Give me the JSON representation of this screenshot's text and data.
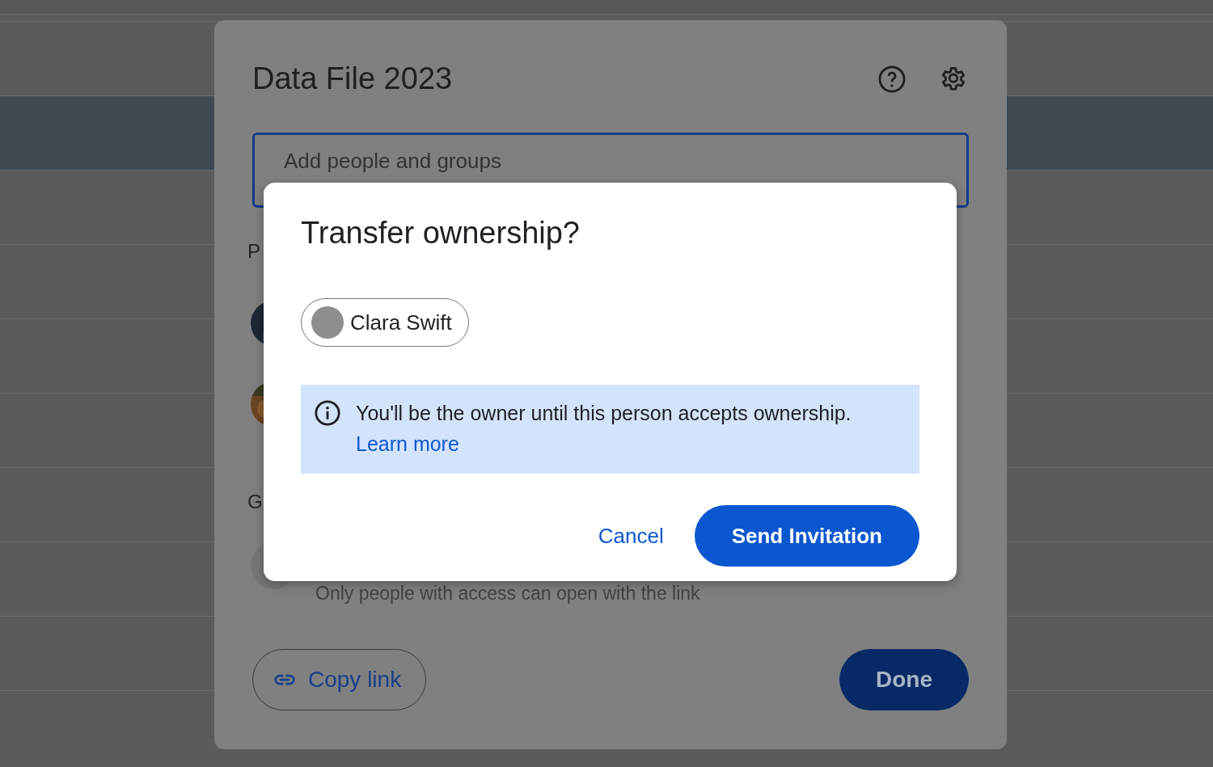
{
  "background_rows": [
    {
      "selected": false
    },
    {
      "selected": true
    },
    {
      "selected": false
    },
    {
      "selected": false
    },
    {
      "selected": false
    },
    {
      "selected": false
    },
    {
      "selected": false
    },
    {
      "selected": false
    },
    {
      "selected": false
    },
    {
      "selected": false
    }
  ],
  "share_dialog": {
    "title": "Data File 2023",
    "field": {
      "placeholder": "Add people and groups"
    },
    "people_heading": "P",
    "access_heading": "G",
    "access_description": "Only people with access can open with the link",
    "copy_link": "Copy link",
    "done": "Done"
  },
  "transfer_dialog": {
    "title": "Transfer ownership?",
    "recipient": "Clara Swift",
    "info": "You'll be the owner until this person accepts ownership.",
    "learn_more": "Learn more",
    "cancel": "Cancel",
    "confirm": "Send Invitation"
  }
}
